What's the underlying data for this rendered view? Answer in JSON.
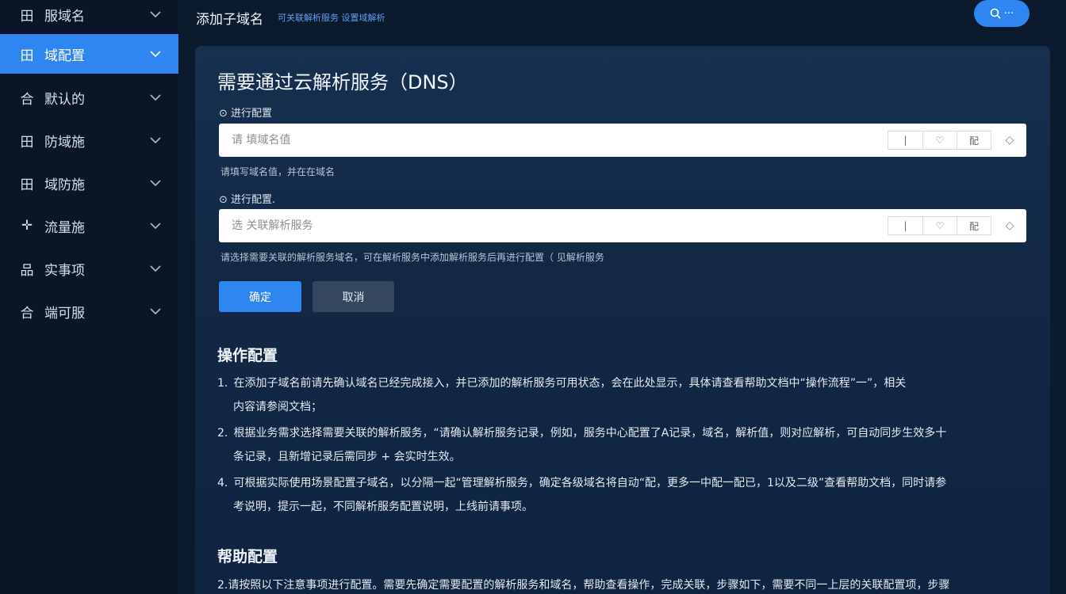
{
  "sidebar": {
    "items": [
      {
        "icon": "grid-icon",
        "glyph": "田",
        "label": "服域名"
      },
      {
        "icon": "grid-icon",
        "glyph": "田",
        "label": "域配置"
      },
      {
        "icon": "house-icon",
        "glyph": "合",
        "label": "默认的"
      },
      {
        "icon": "grid-icon",
        "glyph": "田",
        "label": "防域施"
      },
      {
        "icon": "grid-icon",
        "glyph": "田",
        "label": "域防施"
      },
      {
        "icon": "arrow-icon",
        "glyph": "✛",
        "label": "流量施"
      },
      {
        "icon": "network-icon",
        "glyph": "品",
        "label": "实事项"
      },
      {
        "icon": "house-icon",
        "glyph": "合",
        "label": "端可服"
      }
    ]
  },
  "header": {
    "title": "添加子域名",
    "subtitle": "可关联解析服务 设置域解析",
    "search_label": "···"
  },
  "panel": {
    "title": "需要通过云解析服务（DNS）",
    "field1": {
      "label": "⊙ 进行配置",
      "placeholder": "请 填域名值",
      "tools": [
        "|",
        "♡",
        "配"
      ],
      "end": "◇",
      "help": "请填写域名值，并在在域名"
    },
    "field2": {
      "label": "⊙ 进行配置.",
      "placeholder": "选 关联解析服务",
      "tools": [
        "|",
        "♡",
        "配"
      ],
      "end": "◇",
      "help": "请选择需要关联的解析服务域名，可在解析服务中添加解析服务后再进行配置（ 见解析服务"
    },
    "primary_button": "确定",
    "secondary_button": "取消",
    "section1_title": "操作配置",
    "steps": [
      {
        "num": "1.",
        "line1": "在添加子域名前请先确认域名已经完成接入，并已添加的解析服务可用状态，会在此处显示，具体请查看帮助文档中“操作流程”一”，相关",
        "line2": "内容请参阅文档；"
      },
      {
        "num": "2.",
        "line1": "根据业务需求选择需要关联的解析服务，“请确认解析服务记录，例如，服务中心配置了A记录，域名，解析值，则对应解析，可自动同步生效多十",
        "line2": "条记录，且新增记录后需同步 + 会实时生效。"
      },
      {
        "num": "4.",
        "line1": "可根据实际使用场景配置子域名，以分隔一起“管理解析服务，确定各级域名将自动“配，更多一中配一配已，1以及二级”查看帮助文档，同时请参",
        "line2": "考说明，提示一起，不同解析服务配置说明，上线前请事项。"
      }
    ],
    "section2_title": "帮助配置",
    "section2_text": "2.请按照以下注意事项进行配置。需要先确定需要配置的解析服务和域名，帮助查看操作，完成关联，步骤如下，需要不同一上层的关联配置项，步骤"
  }
}
